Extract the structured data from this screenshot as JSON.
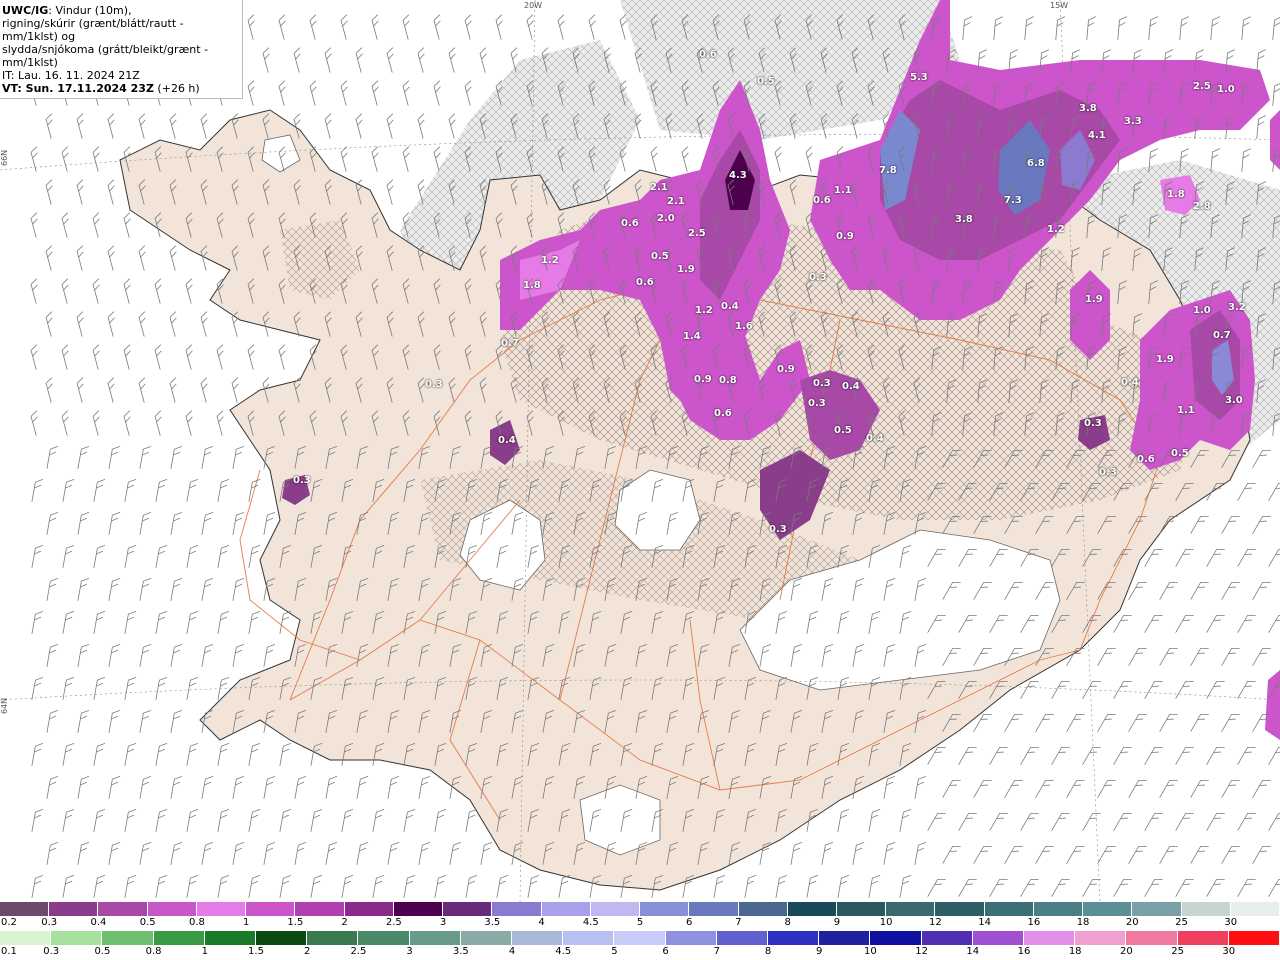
{
  "header": {
    "model_label": "UWC/IG",
    "line1_rest": ": Vindur (10m),",
    "line2": "rigning/skúrir (grænt/blátt/rautt - mm/1klst) og",
    "line3": "slydda/snjókoma (grátt/bleikt/grænt - mm/1klst)",
    "line4": "IT: Lau. 16. 11. 2024 21Z",
    "line5": "VT: Sun. 17.11.2024 23Z",
    "line5_extra": " (+26 h)"
  },
  "coords": {
    "lon_20w": "20W",
    "lon_15w": "15W",
    "lat_66n": "66N",
    "lat_64n": "64N"
  },
  "precip_labels": [
    "4.3",
    "2.1",
    "2.1",
    "2.5",
    "2.0",
    "1.9",
    "1.2",
    "1.8",
    "0.6",
    "0.5",
    "0.6",
    "1.2",
    "0.4",
    "1.6",
    "1.4",
    "0.8",
    "0.9",
    "0.6",
    "0.9",
    "0.3",
    "0.4",
    "0.3",
    "0.5",
    "0.4",
    "0.3",
    "7.8",
    "1.1",
    "0.9",
    "0.6",
    "0.3",
    "3.8",
    "7.3",
    "6.8",
    "1.2",
    "4.1",
    "3.3",
    "3.8",
    "2.5",
    "1.0",
    "1.9",
    "1.8",
    "2.8",
    "1.0",
    "3.2",
    "1.9",
    "1.1",
    "0.6",
    "0.5",
    "3.0",
    "0.3",
    "0.3",
    "0.4",
    "0.7",
    "0.4",
    "0.3",
    "0.3",
    "5.3",
    "0.6",
    "0.5",
    "0.7"
  ],
  "legend_snow": {
    "labels": [
      "0.2",
      "0.3",
      "0.4",
      "0.5",
      "0.8",
      "1",
      "1.5",
      "2",
      "2.5",
      "3",
      "3.5",
      "4",
      "4.5",
      "5",
      "6",
      "7",
      "8",
      "9",
      "10",
      "12",
      "14",
      "16",
      "18",
      "20",
      "25",
      "30"
    ],
    "colors": [
      "#6b4a6b",
      "#8a3d8a",
      "#a849a8",
      "#c659c6",
      "#e67ae6",
      "#cc55cc",
      "#b040b0",
      "#8a2a8a",
      "#4d004d",
      "#6a2a7a",
      "#8a7ad0",
      "#a8a0e8",
      "#c0b8f0",
      "#8890d8",
      "#6a78c0",
      "#4a6890",
      "#1a4a5a",
      "#2a5a60",
      "#3a6a70",
      "#2e5f66",
      "#3a6f76",
      "#4a7f86",
      "#5a8f96",
      "#7aa0a8",
      "#c8d4d0",
      "#e8eeea"
    ]
  },
  "legend_rain": {
    "labels": [
      "0.1",
      "0.3",
      "0.5",
      "0.8",
      "1",
      "1.5",
      "2",
      "2.5",
      "3",
      "3.5",
      "4",
      "4.5",
      "5",
      "6",
      "7",
      "8",
      "9",
      "10",
      "12",
      "14",
      "16",
      "18",
      "20",
      "25",
      "30"
    ],
    "colors": [
      "#d8f4d0",
      "#a8e0a0",
      "#6ec070",
      "#3a9a48",
      "#1a7a2a",
      "#0a4a10",
      "#3a7a50",
      "#4a8a68",
      "#6a9a88",
      "#8aaaa8",
      "#a8b8d8",
      "#b8c0f0",
      "#c8ccf8",
      "#9090e0",
      "#6060d0",
      "#3030c0",
      "#2020a0",
      "#1010a0",
      "#5030b0",
      "#a050d0",
      "#e090e8",
      "#f0a0d0",
      "#f07aa0",
      "#f04060",
      "#ff1010"
    ]
  }
}
